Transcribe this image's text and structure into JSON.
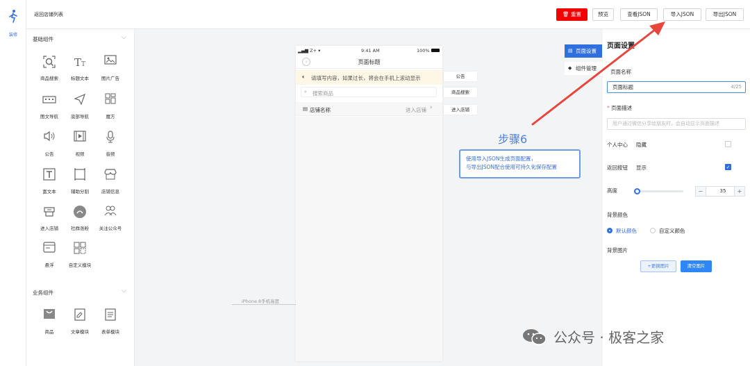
{
  "rail": {
    "logo_icon": "person-run-icon",
    "label": "装修"
  },
  "topbar": {
    "back_link": "返回店铺列表",
    "reset_label": "重置",
    "preview_label": "预览",
    "view_json_label": "查看JSON",
    "import_json_label": "导入JSON",
    "export_json_label": "导出JSON"
  },
  "panel": {
    "basic_title": "基础组件",
    "business_title": "业务组件",
    "basic_items": [
      {
        "label": "商品搜索",
        "icon": "search-icon"
      },
      {
        "label": "标题文本",
        "icon": "text-icon"
      },
      {
        "label": "图片广告",
        "icon": "image-icon"
      },
      {
        "label": "图文导航",
        "icon": "nav-icon"
      },
      {
        "label": "底部导航",
        "icon": "send-icon"
      },
      {
        "label": "魔方",
        "icon": "grid-icon"
      },
      {
        "label": "公告",
        "icon": "speaker-icon"
      },
      {
        "label": "视频",
        "icon": "video-icon"
      },
      {
        "label": "音频",
        "icon": "mic-icon"
      },
      {
        "label": "富文本",
        "icon": "richtext-icon"
      },
      {
        "label": "辅助分割",
        "icon": "divider-icon"
      },
      {
        "label": "店铺信息",
        "icon": "store-icon"
      },
      {
        "label": "进入店铺",
        "icon": "enter-store-icon"
      },
      {
        "label": "社群涨粉",
        "icon": "group-icon"
      },
      {
        "label": "关注公众号",
        "icon": "follow-icon"
      },
      {
        "label": "悬浮",
        "icon": "float-icon"
      },
      {
        "label": "自定义模块",
        "icon": "custom-module-icon"
      }
    ],
    "business_items": [
      {
        "label": "商品",
        "icon": "goods-icon"
      },
      {
        "label": "文章模块",
        "icon": "article-icon"
      },
      {
        "label": "表单模块",
        "icon": "form-icon"
      }
    ]
  },
  "canvas": {
    "iphone_label": "iPhone 8手机高度",
    "phone": {
      "carrier": "Z+",
      "time": "9:41 AM",
      "battery": "100%",
      "nav_title": "页面标题",
      "notice_text": "请填写内容，如果过长，将会在手机上滚动显示",
      "search_placeholder": "搜索商品",
      "store_name": "店铺名称",
      "enter_store": "进入店铺"
    },
    "tags": {
      "notice": "公告",
      "search": "商品搜索",
      "enter": "进入店铺"
    },
    "step_title": "步骤6",
    "step_lines": [
      "使用导入JSON生成页面配置，",
      "与导出JSON配合使用可持久化保存配置"
    ]
  },
  "tabs": {
    "page_settings": "页面设置",
    "components": "组件管理"
  },
  "settings": {
    "title": "页面设置",
    "page_name_label": "页面名称",
    "page_name_value": "页面标题",
    "page_name_count": "4/25",
    "page_desc_label": "页面描述",
    "page_desc_placeholder": "用户通过微信分享给朋友时，会自动显示页面描述",
    "personal_label": "个人中心",
    "personal_value": "隐藏",
    "personal_checked": false,
    "back_btn_label": "返回按钮",
    "back_btn_value": "显示",
    "back_btn_checked": true,
    "height_label": "高度",
    "height_value": "35",
    "height_level": 0,
    "bg_color_label": "背景颜色",
    "bg_default": "默认颜色",
    "bg_custom": "自定义颜色",
    "bg_image_label": "背景图片",
    "change_image": "+更换图片",
    "clear_image": "清空图片"
  },
  "watermark": "公众号 · 极客之家",
  "colors": {
    "accent": "#2f6fde",
    "danger": "#f20000",
    "arrow": "#e8453c",
    "notice_bg": "#fff7e6"
  }
}
